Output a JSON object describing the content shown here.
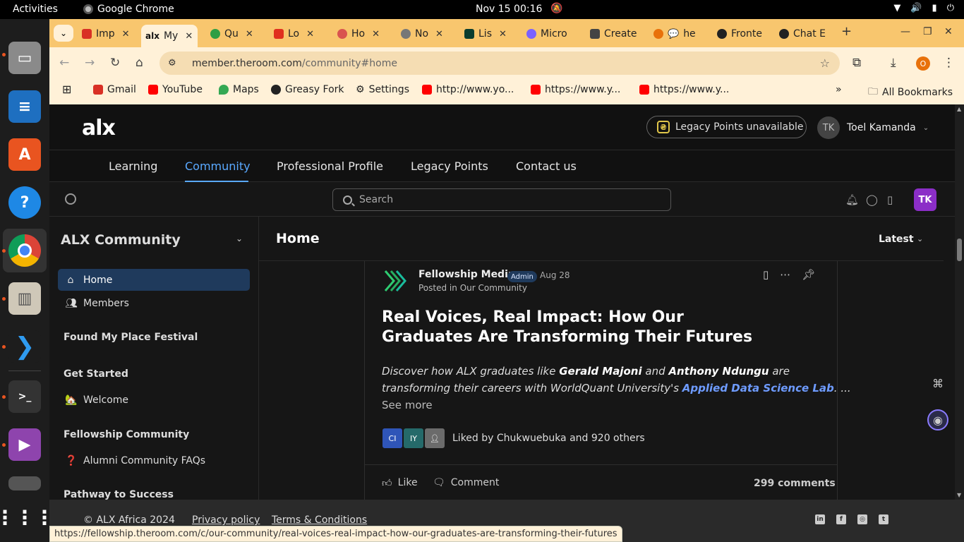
{
  "system": {
    "activities": "Activities",
    "app_name": "Google Chrome",
    "clock": "Nov 15  00:16"
  },
  "browser": {
    "tabs": [
      {
        "label": "Imp",
        "color": "#d93025"
      },
      {
        "label": "My",
        "color": "#111111"
      },
      {
        "label": "Qu",
        "color": "#2e9e44"
      },
      {
        "label": "Lo",
        "color": "#e0301e"
      },
      {
        "label": "Ho",
        "color": "#d9534f"
      },
      {
        "label": "No",
        "color": "#777777"
      },
      {
        "label": "Lis",
        "color": "#0b3d2e"
      },
      {
        "label": "Micro",
        "color": "#7b61ff"
      },
      {
        "label": "Create",
        "color": "#444444"
      },
      {
        "label": "he",
        "color": "#e8710a"
      },
      {
        "label": "Fronte",
        "color": "#222222"
      },
      {
        "label": "Chat E",
        "color": "#222222"
      }
    ],
    "url_host": "member.theroom.com",
    "url_path": "/community#home",
    "profile_initial": "O",
    "bookmarks": [
      {
        "label": "Gmail",
        "color": "#d93025"
      },
      {
        "label": "YouTube",
        "color": "#ff0000"
      },
      {
        "label": "Maps",
        "color": "#34a853"
      },
      {
        "label": "Greasy Fork",
        "color": "#222222"
      },
      {
        "label": "Settings",
        "color": "#444444"
      },
      {
        "label": "http://www.yo...",
        "color": "#ff0000"
      },
      {
        "label": "https://www.y...",
        "color": "#ff0000"
      },
      {
        "label": "https://www.y...",
        "color": "#ff0000"
      }
    ],
    "all_bookmarks": "All Bookmarks",
    "status_url": "https://fellowship.theroom.com/c/our-community/real-voices-real-impact-how-our-graduates-are-transforming-their-futures"
  },
  "site": {
    "logo": "alx",
    "legacy_points": "Legacy Points unavailable",
    "user_initials": "TK",
    "user_name": "Toel Kamanda",
    "nav": [
      "Learning",
      "Community",
      "Professional Profile",
      "Legacy Points",
      "Contact us"
    ],
    "search_placeholder": "Search",
    "badge_initials": "TK"
  },
  "sidebar": {
    "title": "ALX Community",
    "items": [
      {
        "label": "Home",
        "icon": "home-icon"
      },
      {
        "label": "Members",
        "icon": "members-icon"
      }
    ],
    "sections": [
      {
        "heading": "Found My Place Festival"
      },
      {
        "heading": "Get Started",
        "item": "Welcome",
        "emoji": "🏡"
      },
      {
        "heading": "Fellowship Community",
        "item": "Alumni Community FAQs",
        "emoji": "❓"
      },
      {
        "heading": "Pathway to Success"
      }
    ]
  },
  "main": {
    "title": "Home",
    "sort": "Latest"
  },
  "post": {
    "author": "Fellowship Media",
    "role": "Admin",
    "date": "Aug 28",
    "posted_in_prefix": "Posted in ",
    "posted_in": "Our Community",
    "title": "Real Voices, Real Impact: How Our Graduates Are Transforming Their Futures",
    "excerpt_1a": "Discover how ALX graduates like ",
    "excerpt_name1": "Gerald Majoni",
    "excerpt_and": " and ",
    "excerpt_name2": "Anthony Ndungu",
    "excerpt_1b": " are",
    "excerpt_2a": "transforming their careers with WorldQuant University's ",
    "excerpt_link": "Applied Data Science Lab",
    "excerpt_2b": ". ...",
    "see_more": "See more",
    "likers": [
      {
        "initials": "CI",
        "color": "#2f55b8"
      },
      {
        "initials": "IY",
        "color": "#256a6a"
      },
      {
        "initials": "",
        "color": "#6b6b6b"
      }
    ],
    "liked_by": "Liked by Chukwuebuka and 920 others",
    "like_label": "Like",
    "comment_label": "Comment",
    "comments_count": "299 comments"
  },
  "footer": {
    "copyright": "ALX Africa 2024",
    "privacy": "Privacy policy",
    "terms": "Terms & Conditions"
  }
}
